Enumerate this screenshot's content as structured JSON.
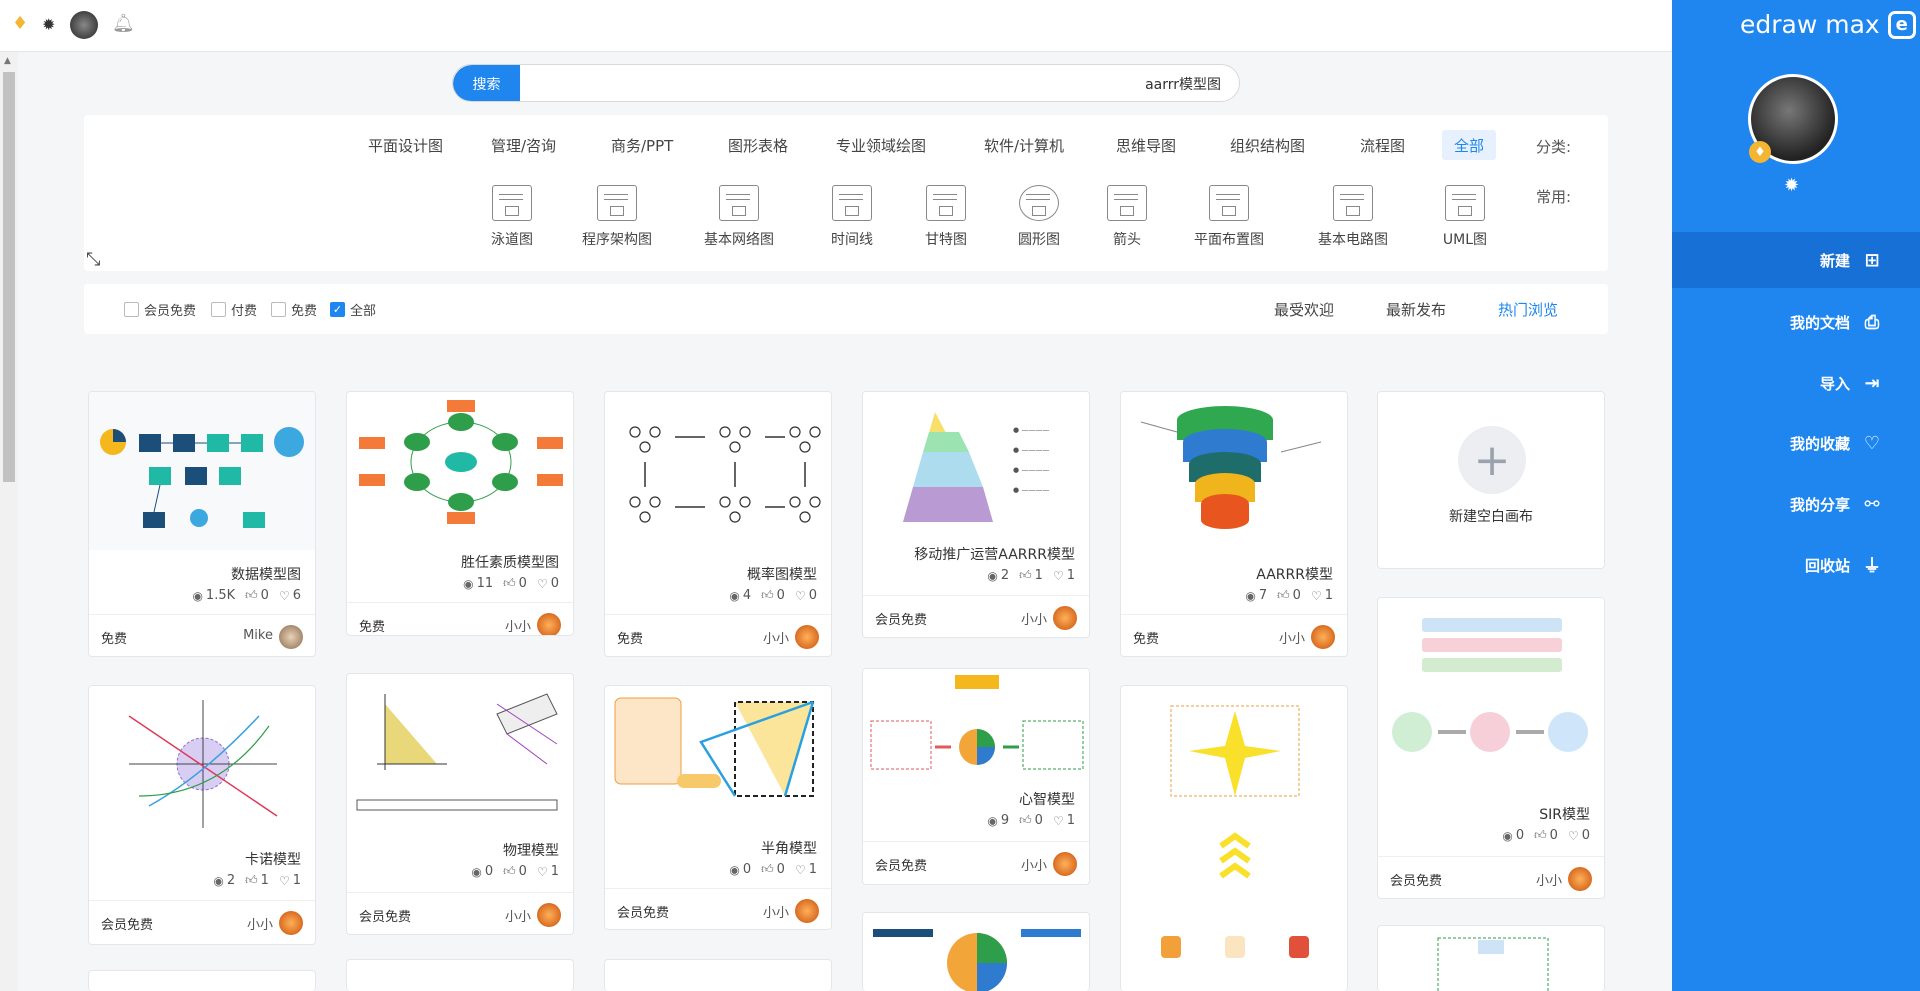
{
  "sidebar": {
    "brand": "edraw max",
    "brand_icon": "e",
    "nav": [
      {
        "label": "新建",
        "icon": "new-file-icon",
        "glyph": "⊞",
        "active": true
      },
      {
        "label": "我的文档",
        "icon": "document-icon",
        "glyph": "⎙",
        "active": false
      },
      {
        "label": "导入",
        "icon": "import-icon",
        "glyph": "⇥",
        "active": false
      },
      {
        "label": "我的收藏",
        "icon": "heart-icon",
        "glyph": "♡",
        "active": false
      },
      {
        "label": "我的分享",
        "icon": "share-icon",
        "glyph": "⚯",
        "active": false
      },
      {
        "label": "回收站",
        "icon": "recycle-bin-icon",
        "glyph": "⏚",
        "active": false
      }
    ]
  },
  "search": {
    "button": "搜索",
    "value": "aarrr模型图"
  },
  "filters": {
    "category_label": "分类:",
    "categories": [
      "全部",
      "流程图",
      "组织结构图",
      "思维导图",
      "软件/计算机",
      "专业领域绘图",
      "图形表格",
      "商务/PPT",
      "管理/咨询",
      "平面设计图"
    ],
    "common_label": "常用:",
    "templates": [
      "UML图",
      "基本电路图",
      "平面布置图",
      "箭头",
      "圆形图",
      "甘特图",
      "时间线",
      "基本网络图",
      "程序架构图",
      "泳道图"
    ]
  },
  "sort": {
    "tabs": [
      "热门浏览",
      "最新发布",
      "最受欢迎"
    ],
    "active": "热门浏览"
  },
  "price_filters": [
    {
      "label": "全部",
      "checked": true
    },
    {
      "label": "免费",
      "checked": false
    },
    {
      "label": "付费",
      "checked": false
    },
    {
      "label": "会员免费",
      "checked": false
    }
  ],
  "new_canvas": {
    "label": "新建空白画布"
  },
  "cards": [
    {
      "title": "AARRR模型",
      "views": "7",
      "likes": "0",
      "favs": "1",
      "author": "小小",
      "price": "免费"
    },
    {
      "title": "移动推广运营AARRR模型",
      "views": "2",
      "likes": "1",
      "favs": "1",
      "author": "小小",
      "price": "会员免费"
    },
    {
      "title": "概率图模型",
      "views": "4",
      "likes": "0",
      "favs": "0",
      "author": "小小",
      "price": "免费"
    },
    {
      "title": "胜任素质模型图",
      "views": "11",
      "likes": "0",
      "favs": "0",
      "author": "小小",
      "price": "免费"
    },
    {
      "title": "数据模型图",
      "views": "1.5K",
      "likes": "0",
      "favs": "6",
      "author": "Mike",
      "price": "免费"
    },
    {
      "title": "SIR模型",
      "views": "0",
      "likes": "0",
      "favs": "0",
      "author": "小小",
      "price": "会员免费"
    },
    {
      "title": "心智模型",
      "views": "9",
      "likes": "0",
      "favs": "1",
      "author": "小小",
      "price": "会员免费"
    },
    {
      "title": "半角模型",
      "views": "0",
      "likes": "0",
      "favs": "1",
      "author": "小小",
      "price": "会员免费"
    },
    {
      "title": "物理模型",
      "views": "0",
      "likes": "0",
      "favs": "1",
      "author": "小小",
      "price": "会员免费"
    },
    {
      "title": "卡诺模型",
      "views": "2",
      "likes": "1",
      "favs": "1",
      "author": "小小",
      "price": "会员免费"
    }
  ],
  "colors": {
    "accent": "#1f86ef",
    "sidebar_active": "#1670d6"
  }
}
